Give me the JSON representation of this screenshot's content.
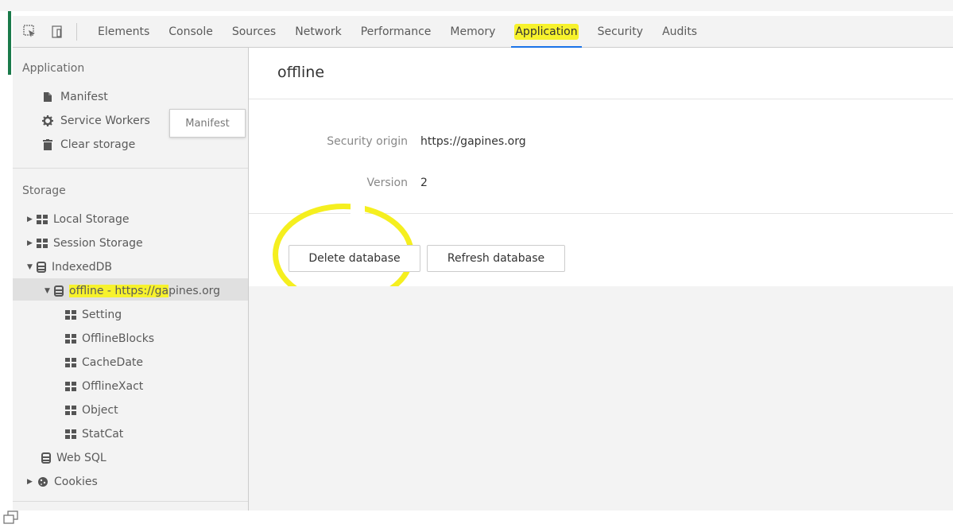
{
  "toolbar": {
    "tabs": [
      {
        "label": "Elements"
      },
      {
        "label": "Console"
      },
      {
        "label": "Sources"
      },
      {
        "label": "Network"
      },
      {
        "label": "Performance"
      },
      {
        "label": "Memory"
      },
      {
        "label": "Application",
        "active": true
      },
      {
        "label": "Security"
      },
      {
        "label": "Audits"
      }
    ]
  },
  "sidebar": {
    "application_title": "Application",
    "application_items": [
      {
        "label": "Manifest",
        "icon": "file-icon"
      },
      {
        "label": "Service Workers",
        "icon": "gear-icon"
      },
      {
        "label": "Clear storage",
        "icon": "trash-icon"
      }
    ],
    "tooltip": "Manifest",
    "storage_title": "Storage",
    "storage": {
      "local_storage": "Local Storage",
      "session_storage": "Session Storage",
      "indexeddb": "IndexedDB",
      "db_entry_highlighted": "offline - https://ga",
      "db_entry_rest": "pines.org",
      "stores": [
        "Setting",
        "OfflineBlocks",
        "CacheDate",
        "OfflineXact",
        "Object",
        "StatCat"
      ],
      "web_sql": "Web SQL",
      "cookies": "Cookies"
    }
  },
  "main": {
    "title": "offline",
    "security_origin_label": "Security origin",
    "security_origin_value": "https://gapines.org",
    "version_label": "Version",
    "version_value": "2",
    "delete_button": "Delete database",
    "refresh_button": "Refresh database"
  },
  "colors": {
    "highlight": "#f7f22c",
    "active_tab_underline": "#1a73e8",
    "panel_bg": "#f3f3f3"
  }
}
